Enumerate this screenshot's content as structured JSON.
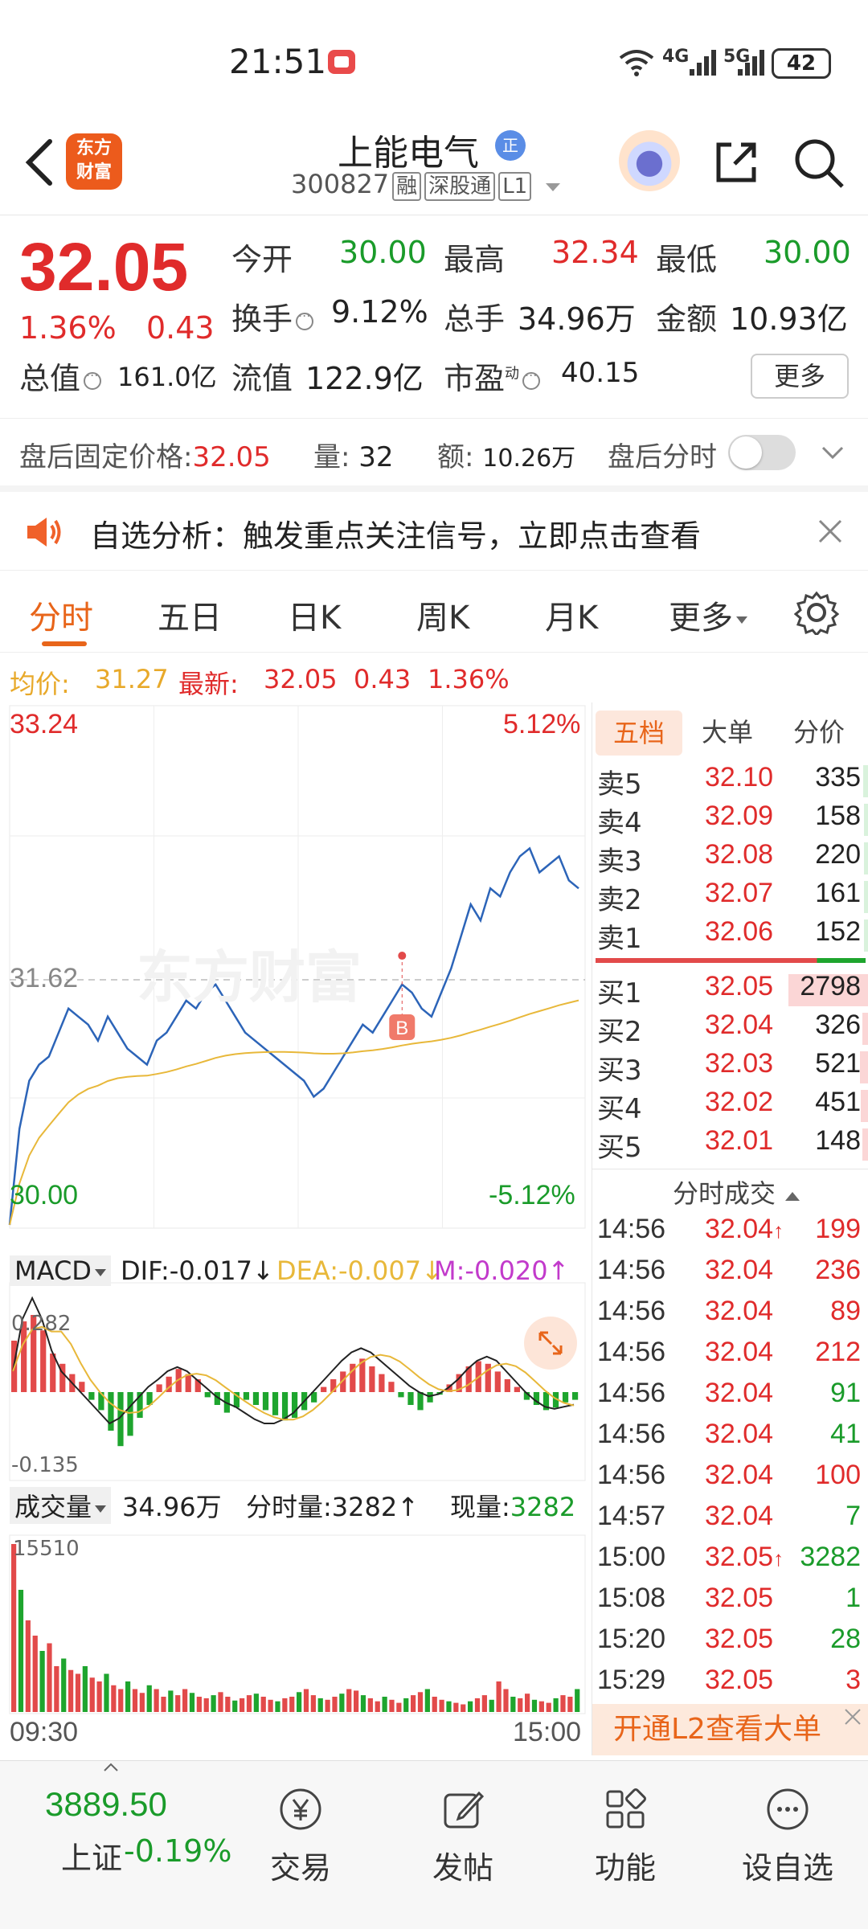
{
  "status_bar": {
    "time": "21:51",
    "net1": "4G",
    "net2": "5G",
    "battery": "42"
  },
  "header": {
    "stock_name": "上能电气",
    "badge": "正",
    "code": "300827",
    "tags": [
      "融",
      "深股通",
      "L1"
    ],
    "logo_text": "东方财富"
  },
  "quote": {
    "price": "32.05",
    "change_pct": "1.36%",
    "change": "0.43",
    "fields": [
      {
        "label": "今开",
        "value": "30.00",
        "color": "green"
      },
      {
        "label": "最高",
        "value": "32.34",
        "color": "red"
      },
      {
        "label": "最低",
        "value": "30.00",
        "color": "green"
      },
      {
        "label": "换手",
        "value": "9.12%",
        "color": "dark"
      },
      {
        "label": "总手",
        "value": "34.96万",
        "color": "dark"
      },
      {
        "label": "金额",
        "value": "10.93亿",
        "color": "dark"
      },
      {
        "label": "总值",
        "value": "161.0亿",
        "color": "dark"
      },
      {
        "label": "流值",
        "value": "122.9亿",
        "color": "dark"
      },
      {
        "label": "市盈",
        "value": "40.15",
        "color": "dark"
      }
    ],
    "pe_sup": "动",
    "more_label": "更多"
  },
  "after_hours": {
    "fixed_price_label": "盘后固定价格:",
    "fixed_price": "32.05",
    "vol_label": "量:",
    "vol": "32",
    "amount_label": "额:",
    "amount": "10.26万",
    "toggle_label": "盘后分时"
  },
  "alert": {
    "text": "自选分析：触发重点关注信号，立即点击查看"
  },
  "tabs": [
    "分时",
    "五日",
    "日K",
    "周K",
    "月K",
    "更多"
  ],
  "avg_line": {
    "avg_label": "均价:",
    "avg_value": "31.27",
    "latest_label": "最新:",
    "latest_value": "32.05",
    "change": "0.43",
    "pct": "1.36%"
  },
  "chart": {
    "y_top": "33.24",
    "y_mid": "31.62",
    "y_bottom": "30.00",
    "pct_top": "5.12%",
    "pct_bottom": "-5.12%",
    "buy_marker": "B",
    "watermark": "东方财富",
    "macd": {
      "label": "MACD",
      "dif": "DIF:-0.017",
      "dea": "DEA:-0.007",
      "m": "M:-0.020",
      "top": "0.282",
      "bottom": "-0.135"
    },
    "volume": {
      "label": "成交量",
      "total": "34.96万",
      "tick_vol": "分时量:3282",
      "cur_vol": "现量:3282",
      "max": "15510"
    },
    "time_start": "09:30",
    "time_end": "15:00",
    "colors": {
      "price_line": "#2c64b8",
      "avg_line": "#e8b83a",
      "up": "#e24a4a",
      "down": "#1ea52e"
    }
  },
  "orderbook": {
    "tabs": [
      "五档",
      "大单",
      "分价"
    ],
    "asks": [
      {
        "label": "卖5",
        "price": "32.10",
        "vol": "335"
      },
      {
        "label": "卖4",
        "price": "32.09",
        "vol": "158"
      },
      {
        "label": "卖3",
        "price": "32.08",
        "vol": "220"
      },
      {
        "label": "卖2",
        "price": "32.07",
        "vol": "161"
      },
      {
        "label": "卖1",
        "price": "32.06",
        "vol": "152"
      }
    ],
    "bids": [
      {
        "label": "买1",
        "price": "32.05",
        "vol": "2798"
      },
      {
        "label": "买2",
        "price": "32.04",
        "vol": "326"
      },
      {
        "label": "买3",
        "price": "32.03",
        "vol": "521"
      },
      {
        "label": "买4",
        "price": "32.02",
        "vol": "451"
      },
      {
        "label": "买5",
        "price": "32.01",
        "vol": "148"
      }
    ],
    "trades_title": "分时成交",
    "trades": [
      {
        "time": "14:56",
        "price": "32.04",
        "arrow": "↑",
        "vol": "199",
        "color": "red"
      },
      {
        "time": "14:56",
        "price": "32.04",
        "arrow": "",
        "vol": "236",
        "color": "red"
      },
      {
        "time": "14:56",
        "price": "32.04",
        "arrow": "",
        "vol": "89",
        "color": "red"
      },
      {
        "time": "14:56",
        "price": "32.04",
        "arrow": "",
        "vol": "212",
        "color": "red"
      },
      {
        "time": "14:56",
        "price": "32.04",
        "arrow": "",
        "vol": "91",
        "color": "green"
      },
      {
        "time": "14:56",
        "price": "32.04",
        "arrow": "",
        "vol": "41",
        "color": "green"
      },
      {
        "time": "14:56",
        "price": "32.04",
        "arrow": "",
        "vol": "100",
        "color": "red"
      },
      {
        "time": "14:57",
        "price": "32.04",
        "arrow": "",
        "vol": "7",
        "color": "green"
      },
      {
        "time": "15:00",
        "price": "32.05",
        "arrow": "↑",
        "vol": "3282",
        "color": "green"
      },
      {
        "time": "15:08",
        "price": "32.05",
        "arrow": "",
        "vol": "1",
        "color": "green"
      },
      {
        "time": "15:20",
        "price": "32.05",
        "arrow": "",
        "vol": "28",
        "color": "green"
      },
      {
        "time": "15:29",
        "price": "32.05",
        "arrow": "",
        "vol": "3",
        "color": "red"
      }
    ],
    "l2_banner": "开通L2查看大单"
  },
  "bottom_nav": {
    "index_value": "3889.50",
    "index_name": "上证",
    "index_change": "-0.19%",
    "items": [
      "交易",
      "发帖",
      "功能",
      "设自选"
    ]
  }
}
